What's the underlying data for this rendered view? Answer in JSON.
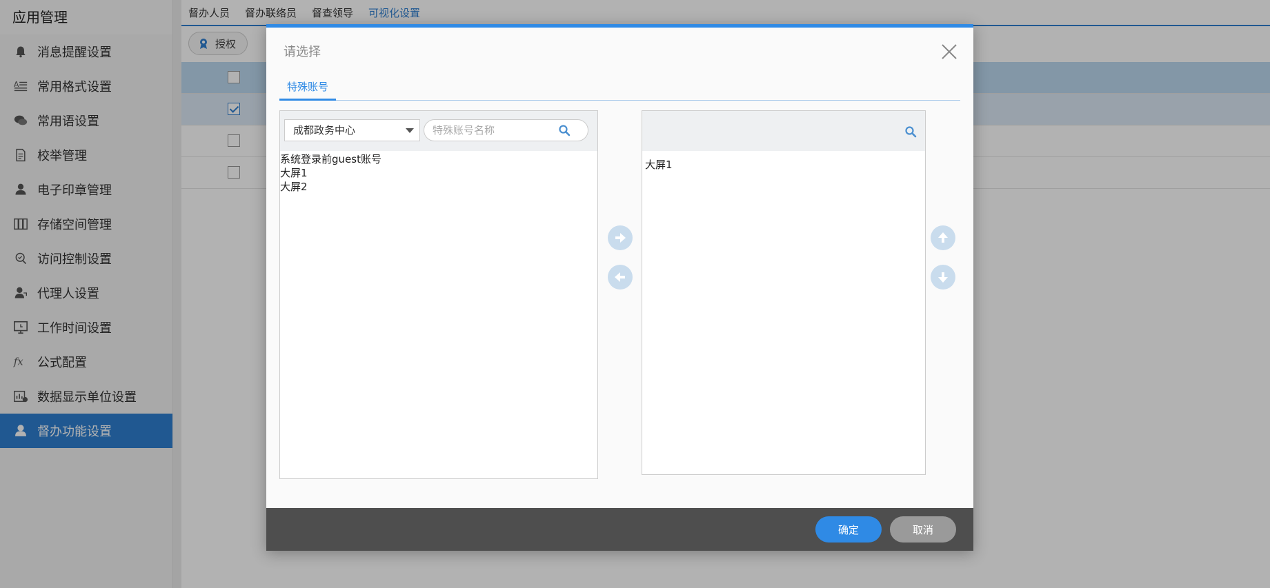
{
  "sidebar": {
    "title": "应用管理",
    "items": [
      {
        "label": "消息提醒设置",
        "icon": "bell-icon"
      },
      {
        "label": "常用格式设置",
        "icon": "text-format-icon"
      },
      {
        "label": "常用语设置",
        "icon": "chat-icon"
      },
      {
        "label": "校举管理",
        "icon": "document-icon"
      },
      {
        "label": "电子印章管理",
        "icon": "seal-icon"
      },
      {
        "label": "存储空间管理",
        "icon": "storage-icon"
      },
      {
        "label": "访问控制设置",
        "icon": "access-control-icon"
      },
      {
        "label": "代理人设置",
        "icon": "agent-icon"
      },
      {
        "label": "工作时间设置",
        "icon": "monitor-clock-icon"
      },
      {
        "label": "公式配置",
        "icon": "formula-icon"
      },
      {
        "label": "数据显示单位设置",
        "icon": "data-unit-icon"
      },
      {
        "label": "督办功能设置",
        "icon": "user-icon",
        "active": true
      }
    ]
  },
  "topnav": {
    "tabs": [
      "督办人员",
      "督办联络员",
      "督查领导",
      "可视化设置"
    ],
    "active_index": 3
  },
  "toolbar": {
    "authorize_label": "授权"
  },
  "table": {
    "rows": [
      {
        "type": "header",
        "checked": false
      },
      {
        "type": "row",
        "checked": true
      },
      {
        "type": "row",
        "checked": false
      },
      {
        "type": "row",
        "checked": false
      }
    ]
  },
  "dialog": {
    "title": "请选择",
    "tab_label": "特殊账号",
    "left": {
      "org_select_value": "成都政务中心",
      "search_placeholder": "特殊账号名称",
      "items": [
        "系统登录前guest账号",
        "大屏1",
        "大屏2"
      ]
    },
    "right": {
      "items": [
        "大屏1"
      ]
    },
    "ok_label": "确定",
    "cancel_label": "取消"
  },
  "colors": {
    "accent": "#2f8ae5",
    "sidebar_active": "#2f7fd0",
    "footer": "#4e4e4e"
  }
}
